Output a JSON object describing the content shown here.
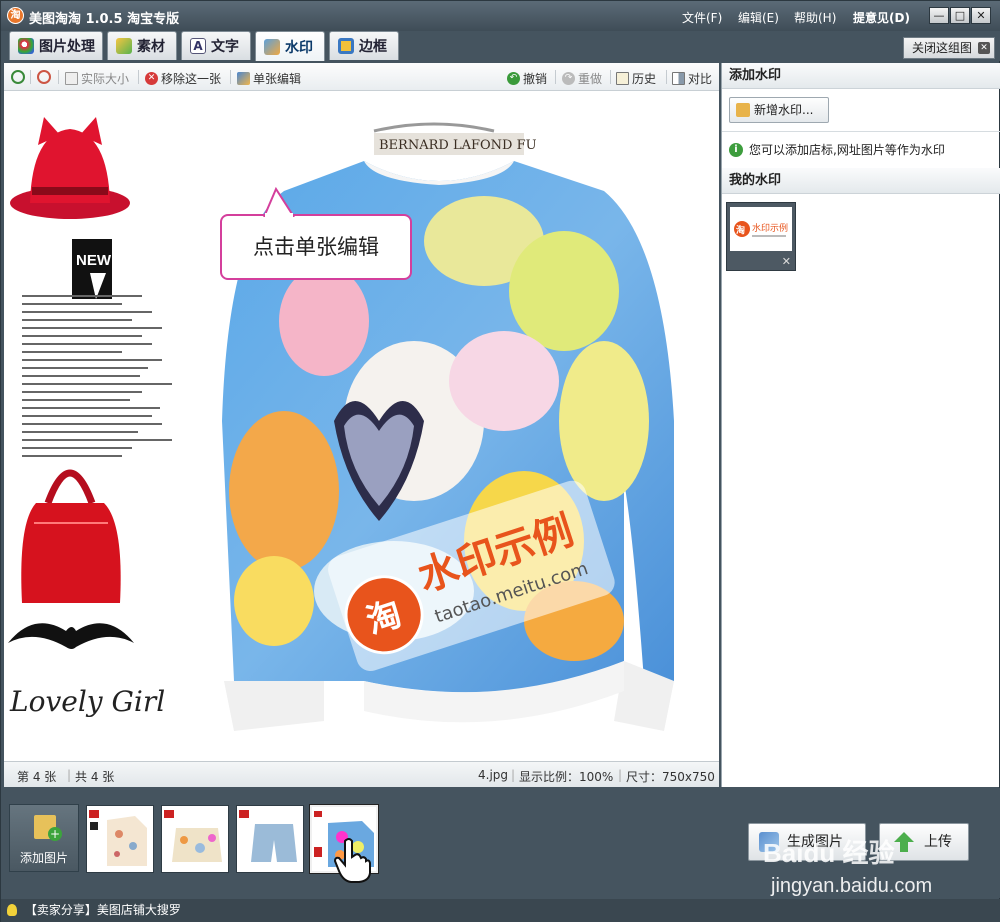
{
  "window": {
    "title": "美图淘淘 1.0.5 淘宝专版",
    "logo_char": "淘",
    "menus": [
      "文件(F)",
      "编辑(E)",
      "帮助(H)",
      "提意见(D)"
    ],
    "controls": [
      "—",
      "□",
      "✕"
    ]
  },
  "tabs": [
    {
      "label": "图片处理",
      "active": false
    },
    {
      "label": "素材",
      "active": false
    },
    {
      "label": "文字",
      "active": false
    },
    {
      "label": "水印",
      "active": true
    },
    {
      "label": "边框",
      "active": false
    }
  ],
  "close_group": {
    "label": "关闭这组图",
    "icon": "close-icon"
  },
  "toolbar": {
    "actual_size": "实际大小",
    "remove_one": "移除这一张",
    "single_edit": "单张编辑",
    "undo": "撤销",
    "redo": "重做",
    "history": "历史",
    "compare": "对比"
  },
  "callout": {
    "text": "点击单张编辑"
  },
  "canvas": {
    "shirt_tag": "BERNARD LAFOND FU",
    "watermark_cn": "水印示例",
    "watermark_url": "taotao.meitu.com",
    "watermark_logo": "淘",
    "new_label": "NEW",
    "lovely_girl": "Lovely Girl"
  },
  "status": {
    "index": "第 4 张",
    "total": "共 4 张",
    "filename": "4.jpg",
    "zoom": "显示比例：100%",
    "size": "尺寸：750x750"
  },
  "right_panel": {
    "add_watermark_title": "添加水印",
    "new_watermark_btn": "新增水印...",
    "tip": "您可以添加店标,网址图片等作为水印",
    "tip_icon": "i",
    "my_watermark_title": "我的水印",
    "wm_thumb_text": "水印示例",
    "wm_thumb_logo": "淘"
  },
  "bottom": {
    "add_image": "添加图片",
    "generate": "生成图片",
    "upload": "上传"
  },
  "footer": {
    "text": "【卖家分享】美图店铺大搜罗"
  },
  "baidu_watermark": {
    "logo": "Baidu 经验",
    "url": "jingyan.baidu.com"
  },
  "colors": {
    "accent": "#d43f9c",
    "watermark": "#e8541c",
    "toolbar_bg": "#45545f"
  }
}
